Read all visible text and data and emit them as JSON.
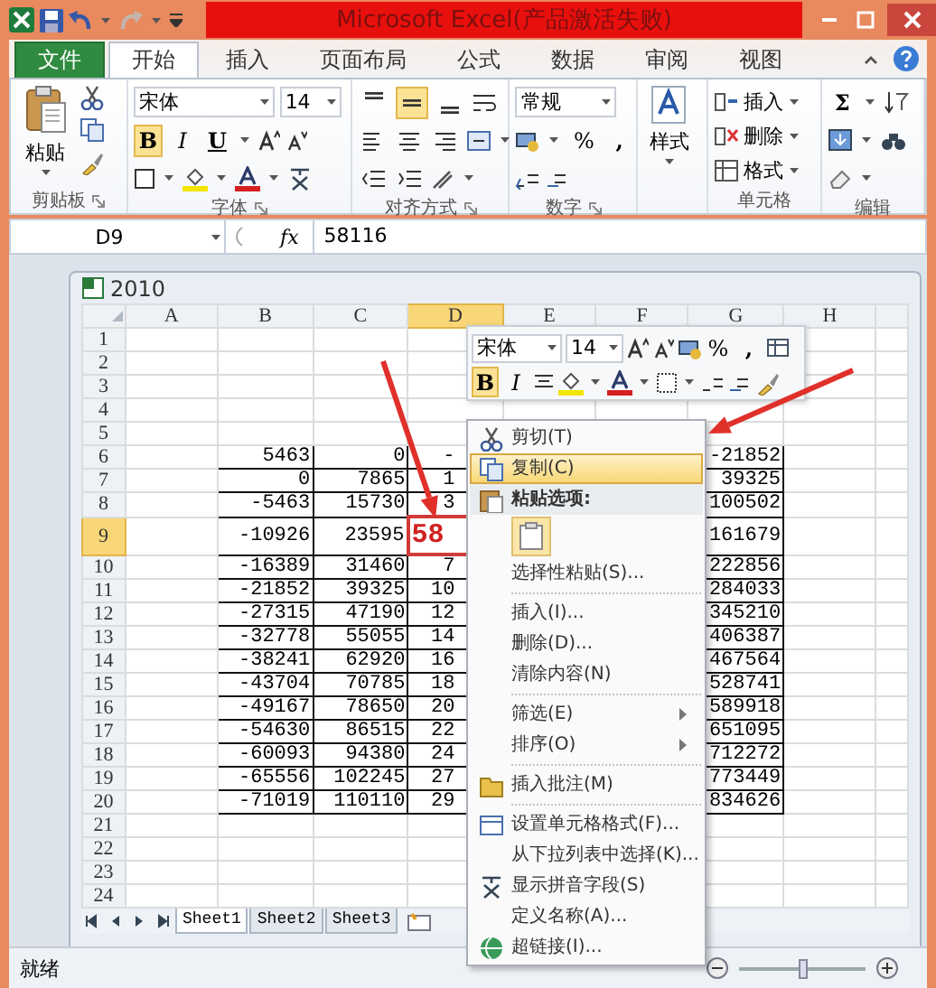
{
  "title_bar": {
    "title": "Microsoft Excel(产品激活失败)"
  },
  "tabs": [
    {
      "label": "文件",
      "kind": "file",
      "selected": false
    },
    {
      "label": "开始",
      "kind": "tab",
      "selected": true
    },
    {
      "label": "插入",
      "kind": "tab",
      "selected": false
    },
    {
      "label": "页面布局",
      "kind": "tab",
      "selected": false
    },
    {
      "label": "公式",
      "kind": "tab",
      "selected": false
    },
    {
      "label": "数据",
      "kind": "tab",
      "selected": false
    },
    {
      "label": "审阅",
      "kind": "tab",
      "selected": false
    },
    {
      "label": "视图",
      "kind": "tab",
      "selected": false
    }
  ],
  "ribbon": {
    "clipboard": {
      "paste": "粘贴",
      "label": "剪贴板"
    },
    "font": {
      "name": "宋体",
      "size": "14",
      "bold_text": "B",
      "italic_text": "I",
      "underline_text": "U",
      "bold": true,
      "label": "字体"
    },
    "alignment": {
      "vertical": [
        {
          "kind": "top",
          "selected": false
        },
        {
          "kind": "middle",
          "selected": true
        },
        {
          "kind": "bottom",
          "selected": false
        }
      ],
      "label": "对齐方式"
    },
    "number": {
      "format": "常规",
      "percent": "%",
      "comma": ",",
      "label": "数字"
    },
    "styles": {
      "button": "样式"
    },
    "cells": {
      "insert": "插入",
      "delete": "删除",
      "format": "格式",
      "label": "单元格"
    },
    "editing": {
      "sum": "Σ",
      "label": "编辑"
    }
  },
  "formula_bar": {
    "name_box": "D9",
    "fx": "fx",
    "value": "58116"
  },
  "workbook": {
    "title": "2010",
    "columns": [
      {
        "label": "A",
        "selected": false
      },
      {
        "label": "B",
        "selected": false
      },
      {
        "label": "C",
        "selected": false
      },
      {
        "label": "D",
        "selected": true
      },
      {
        "label": "E",
        "selected": false
      },
      {
        "label": "F",
        "selected": false
      },
      {
        "label": "G",
        "selected": false
      },
      {
        "label": "H",
        "selected": false
      }
    ],
    "rows": [
      {
        "label": "1",
        "selected": false
      },
      {
        "label": "2",
        "selected": false
      },
      {
        "label": "3",
        "selected": false
      },
      {
        "label": "4",
        "selected": false
      },
      {
        "label": "5",
        "selected": false
      },
      {
        "label": "6",
        "selected": false,
        "b": "5463",
        "c": "0",
        "d": "-",
        "g": "-21852"
      },
      {
        "label": "7",
        "selected": false,
        "b": "0",
        "c": "7865",
        "d": "1",
        "g": "39325"
      },
      {
        "label": "8",
        "selected": false,
        "b": "-5463",
        "c": "15730",
        "d": "3",
        "g": "100502"
      },
      {
        "label": "9",
        "selected": true,
        "b": "-10926",
        "c": "23595",
        "d": "58",
        "g": "161679"
      },
      {
        "label": "10",
        "selected": false,
        "b": "-16389",
        "c": "31460",
        "d": "7",
        "g": "222856"
      },
      {
        "label": "11",
        "selected": false,
        "b": "-21852",
        "c": "39325",
        "d": "10",
        "g": "284033"
      },
      {
        "label": "12",
        "selected": false,
        "b": "-27315",
        "c": "47190",
        "d": "12",
        "g": "345210"
      },
      {
        "label": "13",
        "selected": false,
        "b": "-32778",
        "c": "55055",
        "d": "14",
        "g": "406387"
      },
      {
        "label": "14",
        "selected": false,
        "b": "-38241",
        "c": "62920",
        "d": "16",
        "g": "467564"
      },
      {
        "label": "15",
        "selected": false,
        "b": "-43704",
        "c": "70785",
        "d": "18",
        "g": "528741"
      },
      {
        "label": "16",
        "selected": false,
        "b": "-49167",
        "c": "78650",
        "d": "20",
        "g": "589918"
      },
      {
        "label": "17",
        "selected": false,
        "b": "-54630",
        "c": "86515",
        "d": "22",
        "g": "651095"
      },
      {
        "label": "18",
        "selected": false,
        "b": "-60093",
        "c": "94380",
        "d": "24",
        "g": "712272"
      },
      {
        "label": "19",
        "selected": false,
        "b": "-65556",
        "c": "102245",
        "d": "27",
        "g": "773449"
      },
      {
        "label": "20",
        "selected": false,
        "b": "-71019",
        "c": "110110",
        "d": "29",
        "g": "834626"
      },
      {
        "label": "21",
        "selected": false
      },
      {
        "label": "22",
        "selected": false
      },
      {
        "label": "23",
        "selected": false
      },
      {
        "label": "24",
        "selected": false
      }
    ],
    "sheet_tabs": [
      {
        "label": "Sheet1",
        "selected": true
      },
      {
        "label": "Sheet2",
        "selected": false
      },
      {
        "label": "Sheet3",
        "selected": false
      }
    ]
  },
  "mini_toolbar": {
    "font": "宋体",
    "size": "14",
    "bold_text": "B",
    "italic_text": "I",
    "percent": "%",
    "comma": ",",
    "bold": true
  },
  "context_menu": [
    {
      "kind": "item",
      "label": "剪切(T)",
      "selected": false
    },
    {
      "kind": "item",
      "label": "复制(C)",
      "selected": true
    },
    {
      "kind": "header",
      "label": "粘贴选项:"
    },
    {
      "kind": "paste_option"
    },
    {
      "kind": "item",
      "label": "选择性粘贴(S)...",
      "selected": false
    },
    {
      "kind": "separator"
    },
    {
      "kind": "item",
      "label": "插入(I)...",
      "selected": false
    },
    {
      "kind": "item",
      "label": "删除(D)...",
      "selected": false
    },
    {
      "kind": "item",
      "label": "清除内容(N)",
      "selected": false
    },
    {
      "kind": "separator"
    },
    {
      "kind": "submenu",
      "label": "筛选(E)",
      "selected": false
    },
    {
      "kind": "submenu",
      "label": "排序(O)",
      "selected": false
    },
    {
      "kind": "separator"
    },
    {
      "kind": "item",
      "label": "插入批注(M)",
      "selected": false
    },
    {
      "kind": "separator"
    },
    {
      "kind": "item",
      "label": "设置单元格格式(F)...",
      "selected": false
    },
    {
      "kind": "item",
      "label": "从下拉列表中选择(K)...",
      "selected": false
    },
    {
      "kind": "item",
      "label": "显示拼音字段(S)",
      "selected": false
    },
    {
      "kind": "item",
      "label": "定义名称(A)...",
      "selected": false
    },
    {
      "kind": "item",
      "label": "超链接(I)...",
      "selected": false
    }
  ],
  "status_bar": {
    "text": "就绪",
    "zoom": {
      "level": 0.5
    }
  }
}
